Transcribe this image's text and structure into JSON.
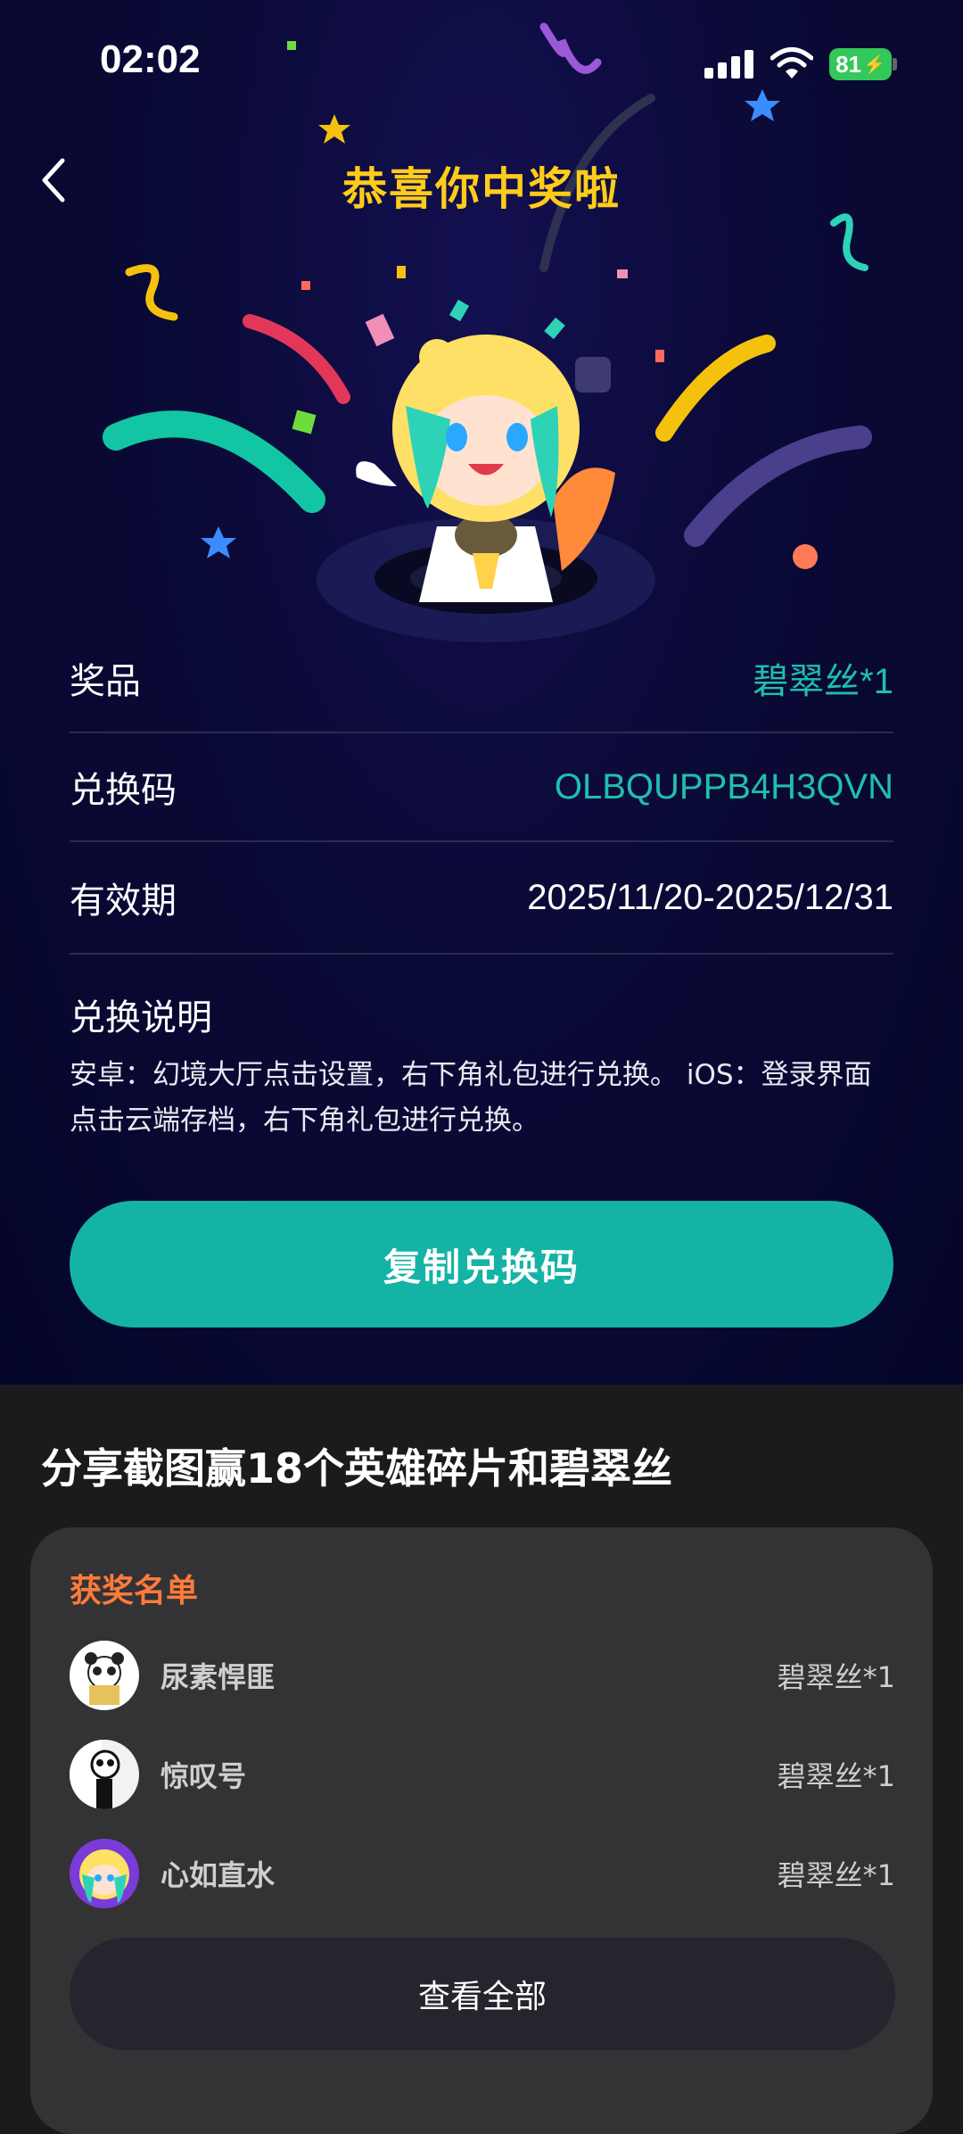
{
  "status_bar": {
    "time": "02:02",
    "battery": "81"
  },
  "header": {
    "title": "恭喜你中奖啦"
  },
  "prize_info": {
    "prize_label": "奖品",
    "prize_value": "碧翠丝*1",
    "code_label": "兑换码",
    "code_value": "OLBQUPPB4H3QVN",
    "validity_label": "有效期",
    "validity_value": "2025/11/20-2025/12/31",
    "instructions_label": "兑换说明",
    "instructions_text": "安卓：幻境大厅点击设置，右下角礼包进行兑换。 iOS：登录界面点击云端存档，右下角礼包进行兑换。"
  },
  "copy_button": "复制兑换码",
  "share": {
    "title": "分享截图赢18个英雄碎片和碧翠丝"
  },
  "winners": {
    "title": "获奖名单",
    "items": [
      {
        "name": "尿素悍匪",
        "prize": "碧翠丝*1"
      },
      {
        "name": "惊叹号",
        "prize": "碧翠丝*1"
      },
      {
        "name": "心如直水",
        "prize": "碧翠丝*1"
      }
    ],
    "view_all": "查看全部"
  },
  "colors": {
    "accent_teal": "#14b3a5",
    "title_yellow": "#ffcc1a",
    "winners_orange": "#ff7b3a"
  }
}
